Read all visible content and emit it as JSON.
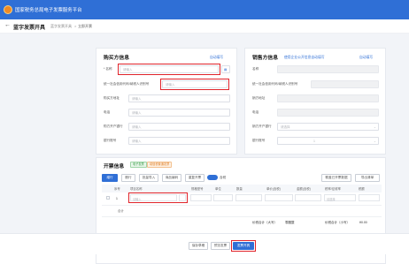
{
  "header": {
    "app_title": "国家税务总局电子发票服务平台"
  },
  "subheader": {
    "back": "←",
    "page_title": "蓝字发票开具",
    "breadcrumb": [
      "蓝字发票开具",
      ">",
      "立即开票"
    ]
  },
  "buyer": {
    "title": "购买方信息",
    "action": "自动填写",
    "fields": [
      {
        "label": "* 名称",
        "placeholder": "请输入"
      },
      {
        "label": "统一社会信用代码/纳税人识别号",
        "placeholder": "请输入"
      },
      {
        "label": "购买方地址",
        "placeholder": "请输入"
      },
      {
        "label": "电话",
        "placeholder": "请输入"
      },
      {
        "label": "购方开户银行",
        "placeholder": "请输入"
      },
      {
        "label": "银行账号",
        "placeholder": "请输入"
      }
    ]
  },
  "seller": {
    "title": "销售方信息",
    "subtitle": "使用企业公开信息自动填写",
    "action": "自动填写",
    "fields": [
      {
        "label": "名称",
        "value": ""
      },
      {
        "label": "统一社会信用代码/纳税人识别号",
        "value": ""
      },
      {
        "label": "销方地址",
        "value": ""
      },
      {
        "label": "电话",
        "value": ""
      },
      {
        "label": "销方开户银行",
        "value": "请选择"
      },
      {
        "label": "银行账号",
        "value": ""
      }
    ],
    "dropdown_value": "1"
  },
  "invoice": {
    "title": "开票信息",
    "tags": [
      "电子发票",
      "增值税普通发票"
    ],
    "buttons": [
      "增行",
      "删行",
      "批量导入",
      "商品编码",
      "重复开票"
    ],
    "toggle_label": "含税",
    "right_buttons": [
      "覆盖已开票数据",
      "导出清单"
    ],
    "columns": [
      "序号",
      "项目名称",
      "规格型号",
      "单位",
      "数量",
      "单价(含税)",
      "金额(含税)",
      "税率/征收率",
      "税额"
    ],
    "row": {
      "index": "1",
      "name_placeholder": "请输入",
      "taxrate": "请选择"
    },
    "subtotal_label": "合计",
    "total_amount_label": "价税合计（大写）",
    "total_amount_value": "零圆整",
    "total_small_label": "价税合计（小写）",
    "total_small_value": "¥0.00"
  },
  "footer": {
    "buttons": [
      "保存草稿",
      "预览发票",
      "发票开具"
    ]
  },
  "colors": {
    "brand": "#2f6fd6",
    "highlight": "#e0242b"
  }
}
